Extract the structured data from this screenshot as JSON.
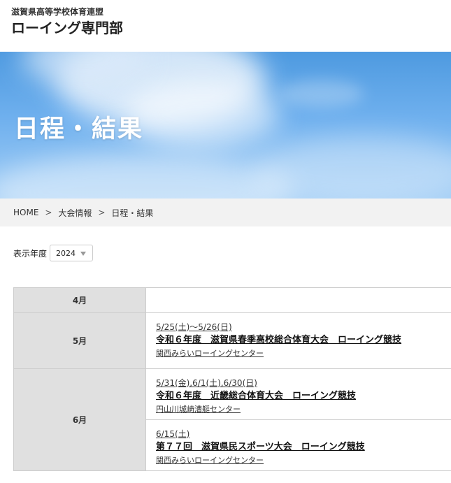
{
  "header": {
    "subtitle": "滋賀県高等学校体育連盟",
    "title": "ローイング専門部"
  },
  "hero": {
    "title": "日程・結果"
  },
  "breadcrumb": {
    "items": [
      "HOME",
      "大会情報",
      "日程・結果"
    ],
    "separator": ">"
  },
  "filter": {
    "label": "表示年度",
    "selected_year": "2024"
  },
  "schedule": {
    "months": [
      {
        "label": "4月",
        "events": []
      },
      {
        "label": "5月",
        "events": [
          {
            "date": "5/25(土)～5/26(日)",
            "title": "令和６年度　滋賀県春季高校総合体育大会　ローイング競技",
            "venue": "関西みらいローイングセンター"
          }
        ]
      },
      {
        "label": "6月",
        "events": [
          {
            "date": "5/31(金),6/1(土),6/30(日)",
            "title": "令和６年度　近畿総合体育大会　ローイング競技",
            "venue": "円山川城崎漕艇センター"
          },
          {
            "date": "6/15(土)",
            "title": "第７７回　滋賀県民スポーツ大会　ローイング競技",
            "venue": "関西みらいローイングセンター"
          }
        ]
      }
    ]
  },
  "colors": {
    "month_cell_bg": "#e0e0e0",
    "breadcrumb_bg": "#f2f2f2",
    "hero_sky": "#6fb0ee"
  }
}
